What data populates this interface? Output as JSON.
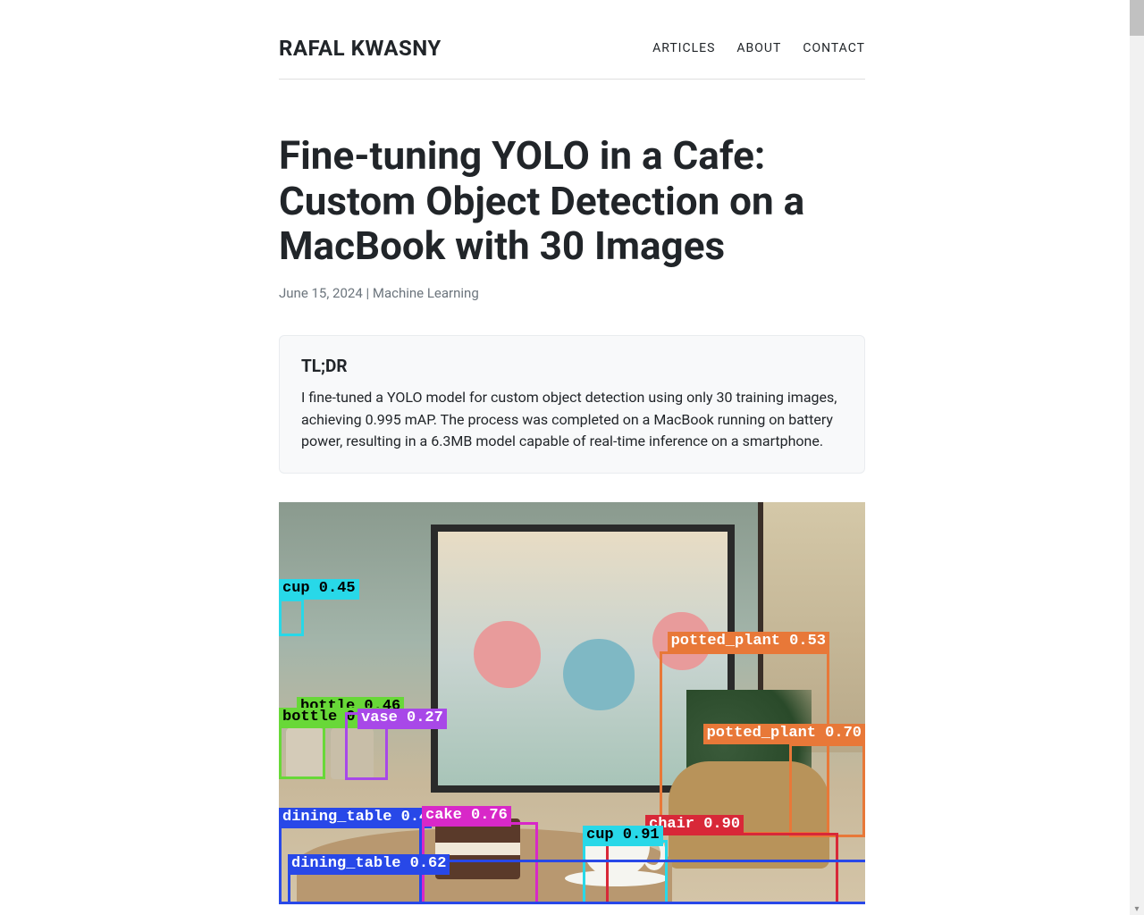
{
  "header": {
    "site_title": "RAFAL KWASNY",
    "nav": {
      "articles": "ARTICLES",
      "about": "ABOUT",
      "contact": "CONTACT"
    }
  },
  "article": {
    "title": "Fine-tuning YOLO in a Cafe: Custom Object Detection on a MacBook with 30 Images",
    "date": "June 15, 2024",
    "separator": " | ",
    "category": "Machine Learning"
  },
  "tldr": {
    "heading": "TL;DR",
    "text": "I fine-tuned a YOLO model for custom object detection using only 30 training images, achieving 0.995 mAP. The process was completed on a MacBook running on battery power, resulting in a 6.3MB model capable of real-time inference on a smartphone."
  },
  "detections": {
    "cup1": "cup 0.45",
    "potted_plant1": "potted_plant 0.53",
    "potted_plant2": "potted_plant 0.70",
    "bottle1": "bottle 0.71",
    "bottle2": "bottle 0.46",
    "vase": "vase 0.27",
    "chair": "chair 0.90",
    "cup2": "cup 0.91",
    "cake": "cake 0.76",
    "dining_table1": "dining_table 0.4",
    "dining_table2": "dining_table 0.62"
  }
}
